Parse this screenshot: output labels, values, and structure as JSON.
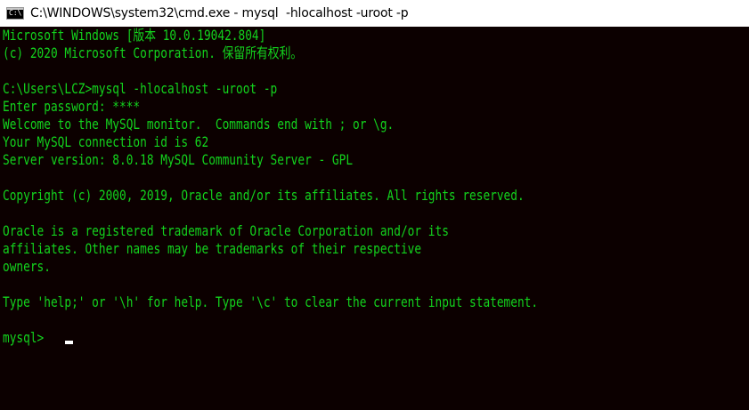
{
  "window": {
    "title": "C:\\WINDOWS\\system32\\cmd.exe - mysql  -hlocalhost -uroot -p",
    "icon": "cmd-console-icon",
    "icon_glyph": "C:\\"
  },
  "console": {
    "text_color": "#13d31d",
    "background_color": "#0c0000",
    "lines": [
      "Microsoft Windows [版本 10.0.19042.804]",
      "(c) 2020 Microsoft Corporation. 保留所有权利。",
      "",
      "C:\\Users\\LCZ>mysql -hlocalhost -uroot -p",
      "Enter password: ****",
      "Welcome to the MySQL monitor.  Commands end with ; or \\g.",
      "Your MySQL connection id is 62",
      "Server version: 8.0.18 MySQL Community Server - GPL",
      "",
      "Copyright (c) 2000, 2019, Oracle and/or its affiliates. All rights reserved.",
      "",
      "Oracle is a registered trademark of Oracle Corporation and/or its",
      "affiliates. Other names may be trademarks of their respective",
      "owners.",
      "",
      "Type 'help;' or '\\h' for help. Type '\\c' to clear the current input statement."
    ],
    "prompt": "mysql> "
  }
}
